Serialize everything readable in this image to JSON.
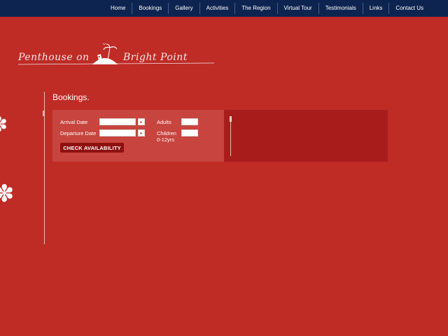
{
  "nav": {
    "items": [
      "Home",
      "Bookings",
      "Gallery",
      "Activities",
      "The Region",
      "Virtual Tour",
      "Testimonials",
      "Links",
      "Contact Us"
    ]
  },
  "logo": {
    "left": "Penthouse on",
    "right": "Bright Point"
  },
  "page": {
    "title": "Bookings."
  },
  "form": {
    "arrival_label": "Arrival Date",
    "arrival_value": "",
    "departure_label": "Departure Date",
    "departure_value": "",
    "adults_label": "Adults",
    "adults_value": "",
    "children_label": "Children",
    "children_sub_label": "0-12yrs",
    "children_value": "",
    "calendar_glyph": "▸",
    "check_button": "CHECK AVAILABILITY"
  },
  "decor": {
    "flower_glyph": "✽"
  },
  "colors": {
    "background": "#bf2b25",
    "topbar": "#0d2450",
    "form_panel": "#c7453e",
    "side_panel": "#a81d1b",
    "button": "#8e100f"
  }
}
